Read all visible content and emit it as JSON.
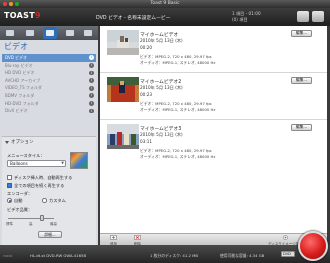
{
  "window": {
    "title": "Toast 9 Basic"
  },
  "header": {
    "logo": "TOAST",
    "logo_num": "9",
    "project_label": "DVD ビデオ - 名称未設定ムービー",
    "status_line1": "1 項目 - 01:00",
    "status_line2": "(0) 項目",
    "icons": [
      "video-icon",
      "photo-icon",
      "music-icon",
      "copy-icon"
    ]
  },
  "sidebar": {
    "category_title": "ビデオ",
    "formats": [
      {
        "label": "DVD ビデオ",
        "selected": true
      },
      {
        "label": "Blu-ray ビデオ",
        "selected": false
      },
      {
        "label": "HD DVD ビデオ",
        "selected": false
      },
      {
        "label": "AVCHD アーカイブ",
        "selected": false
      },
      {
        "label": "VIDEO_TS フォルダ",
        "selected": false
      },
      {
        "label": "BDMV フォルダ",
        "selected": false
      },
      {
        "label": "HD-DVD フォルダ",
        "selected": false
      },
      {
        "label": "DivX ビデオ",
        "selected": false
      }
    ],
    "options": {
      "title": "オプション",
      "menu_style_label": "メニュースタイル：",
      "menu_style_value": "Balloons",
      "auto_play_label": "ディスク挿入時、自動再生する",
      "loop_label": "全ての項目を続く再生する",
      "encoder_label": "エンコーダ：",
      "encoder_auto": "自動",
      "encoder_custom": "カスタム",
      "quality_label": "ビデオ品質：",
      "quality_ticks": [
        "標準",
        "高",
        "最高"
      ],
      "quality_level": 0.75,
      "detail_button": "詳細..."
    }
  },
  "content": {
    "items": [
      {
        "name": "マイホームビデオ",
        "date": "2010年 5月 13日 (木)",
        "duration": "00:20",
        "video_info": "ビデオ：MPEG-2, 720 x 480, 29.97 fps",
        "audio_info": "オーディオ：MPEG-1, ステレオ, 48000 Hz",
        "edit_label": "編集..."
      },
      {
        "name": "マイホームビデオ2",
        "date": "2010年 5月 13日 (木)",
        "duration": "00:23",
        "video_info": "ビデオ：MPEG-2, 720 x 480, 29.97 fps",
        "audio_info": "オーディオ：MPEG-1, ステレオ, 48000 Hz",
        "edit_label": "編集..."
      },
      {
        "name": "マイホームビデオ3",
        "date": "2010年 5月 13日 (木)",
        "duration": "03:11",
        "video_info": "ビデオ：MPEG-2, 720 x 480, 29.97 fps",
        "audio_info": "オーディオ：MPEG-1, ステレオ, 48000 Hz",
        "edit_label": "編集..."
      }
    ]
  },
  "bottom_bar": {
    "add_label": "追加",
    "delete_label": "削除",
    "disc_image_label": "ディスクイメージ保存"
  },
  "statusbar": {
    "drive": "HL-dt-st DVD-RW GWA-4165B",
    "disc_used": "1 枚分のディスク: 41.2 MB",
    "disc_free": "使用可能な容量: 4.34 GB",
    "format": "DVD"
  },
  "colors": {
    "accent": "#2f6fb7",
    "record": "#d81c1c"
  }
}
